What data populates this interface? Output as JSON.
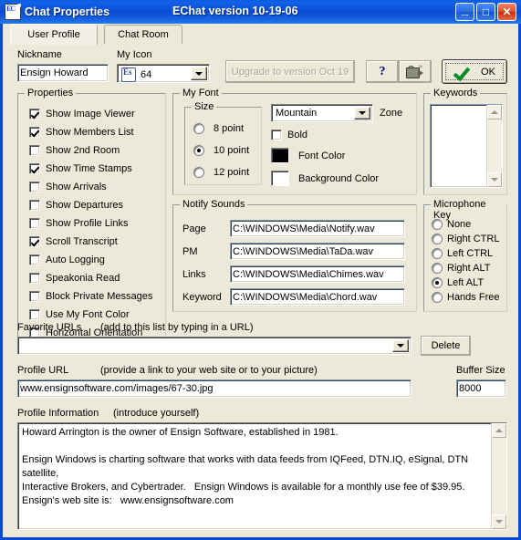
{
  "window": {
    "title": "Chat Properties",
    "subtitle": "EChat version 10-19-06",
    "icon": "echat-document-icon",
    "minimize": "_",
    "maximize": "□",
    "close": "✕"
  },
  "tabs": [
    {
      "label": "User Profile",
      "active": true
    },
    {
      "label": "Chat Room",
      "active": false
    }
  ],
  "top": {
    "nickname_label": "Nickname",
    "nickname_value": "Ensign Howard",
    "myicon_label": "My Icon",
    "myicon_value": "64",
    "upgrade_button": "Upgrade to version Oct 19",
    "help_button": "?",
    "camera_button": "camcorder-icon",
    "ok_button": "OK"
  },
  "properties": {
    "title": "Properties",
    "items": [
      {
        "label": "Show Image Viewer",
        "checked": true
      },
      {
        "label": "Show Members List",
        "checked": true
      },
      {
        "label": "Show 2nd Room",
        "checked": false
      },
      {
        "label": "Show Time Stamps",
        "checked": true
      },
      {
        "label": "Show Arrivals",
        "checked": false
      },
      {
        "label": "Show Departures",
        "checked": false
      },
      {
        "label": "Show Profile Links",
        "checked": false
      },
      {
        "label": "Scroll Transcript",
        "checked": true
      },
      {
        "label": "Auto Logging",
        "checked": false
      },
      {
        "label": "Speakonia Read",
        "checked": false
      },
      {
        "label": "Block Private Messages",
        "checked": false
      },
      {
        "label": "Use My Font Color",
        "checked": false
      },
      {
        "label": "Horizontal Orientation",
        "checked": false
      }
    ]
  },
  "my_font": {
    "title": "My Font",
    "size_title": "Size",
    "sizes": [
      {
        "label": "8 point",
        "selected": false
      },
      {
        "label": "10 point",
        "selected": true
      },
      {
        "label": "12 point",
        "selected": false
      }
    ],
    "zone_value": "Mountain",
    "zone_label": "Zone",
    "bold_label": "Bold",
    "bold_checked": false,
    "font_color_label": "Font Color",
    "font_color": "#000000",
    "background_color_label": "Background Color",
    "background_color": "#ffffff"
  },
  "notify_sounds": {
    "title": "Notify Sounds",
    "rows": [
      {
        "label": "Page",
        "value": "C:\\WINDOWS\\Media\\Notify.wav"
      },
      {
        "label": "PM",
        "value": "C:\\WINDOWS\\Media\\TaDa.wav"
      },
      {
        "label": "Links",
        "value": "C:\\WINDOWS\\Media\\Chimes.wav"
      },
      {
        "label": "Keyword",
        "value": "C:\\WINDOWS\\Media\\Chord.wav"
      }
    ]
  },
  "keywords": {
    "title": "Keywords",
    "value": ""
  },
  "microphone_key": {
    "title": "Microphone Key",
    "options": [
      {
        "label": "None",
        "selected": false
      },
      {
        "label": "Right CTRL",
        "selected": false
      },
      {
        "label": "Left CTRL",
        "selected": false
      },
      {
        "label": "Right ALT",
        "selected": false
      },
      {
        "label": "Left ALT",
        "selected": true
      },
      {
        "label": "Hands Free",
        "selected": false
      }
    ]
  },
  "favorite_urls": {
    "label": "Favorite URLs",
    "hint": "(add to this list by typing in a URL)",
    "value": "",
    "delete_button": "Delete"
  },
  "profile_url": {
    "label": "Profile URL",
    "hint": "(provide a link to your web site or to your picture)",
    "value": "www.ensignsoftware.com/images/67-30.jpg"
  },
  "buffer_size": {
    "label": "Buffer Size",
    "value": "8000"
  },
  "profile_information": {
    "label": "Profile Information",
    "hint": "(introduce yourself)",
    "value": "Howard Arrington is the owner of Ensign Software, established in 1981.\n\nEnsign Windows is charting software that works with data feeds from IQFeed, DTN.IQ, eSignal, DTN satellite,\nInteractive Brokers, and Cybertrader.   Ensign Windows is available for a monthly use fee of $39.95.\nEnsign's web site is:   www.ensignsoftware.com"
  }
}
